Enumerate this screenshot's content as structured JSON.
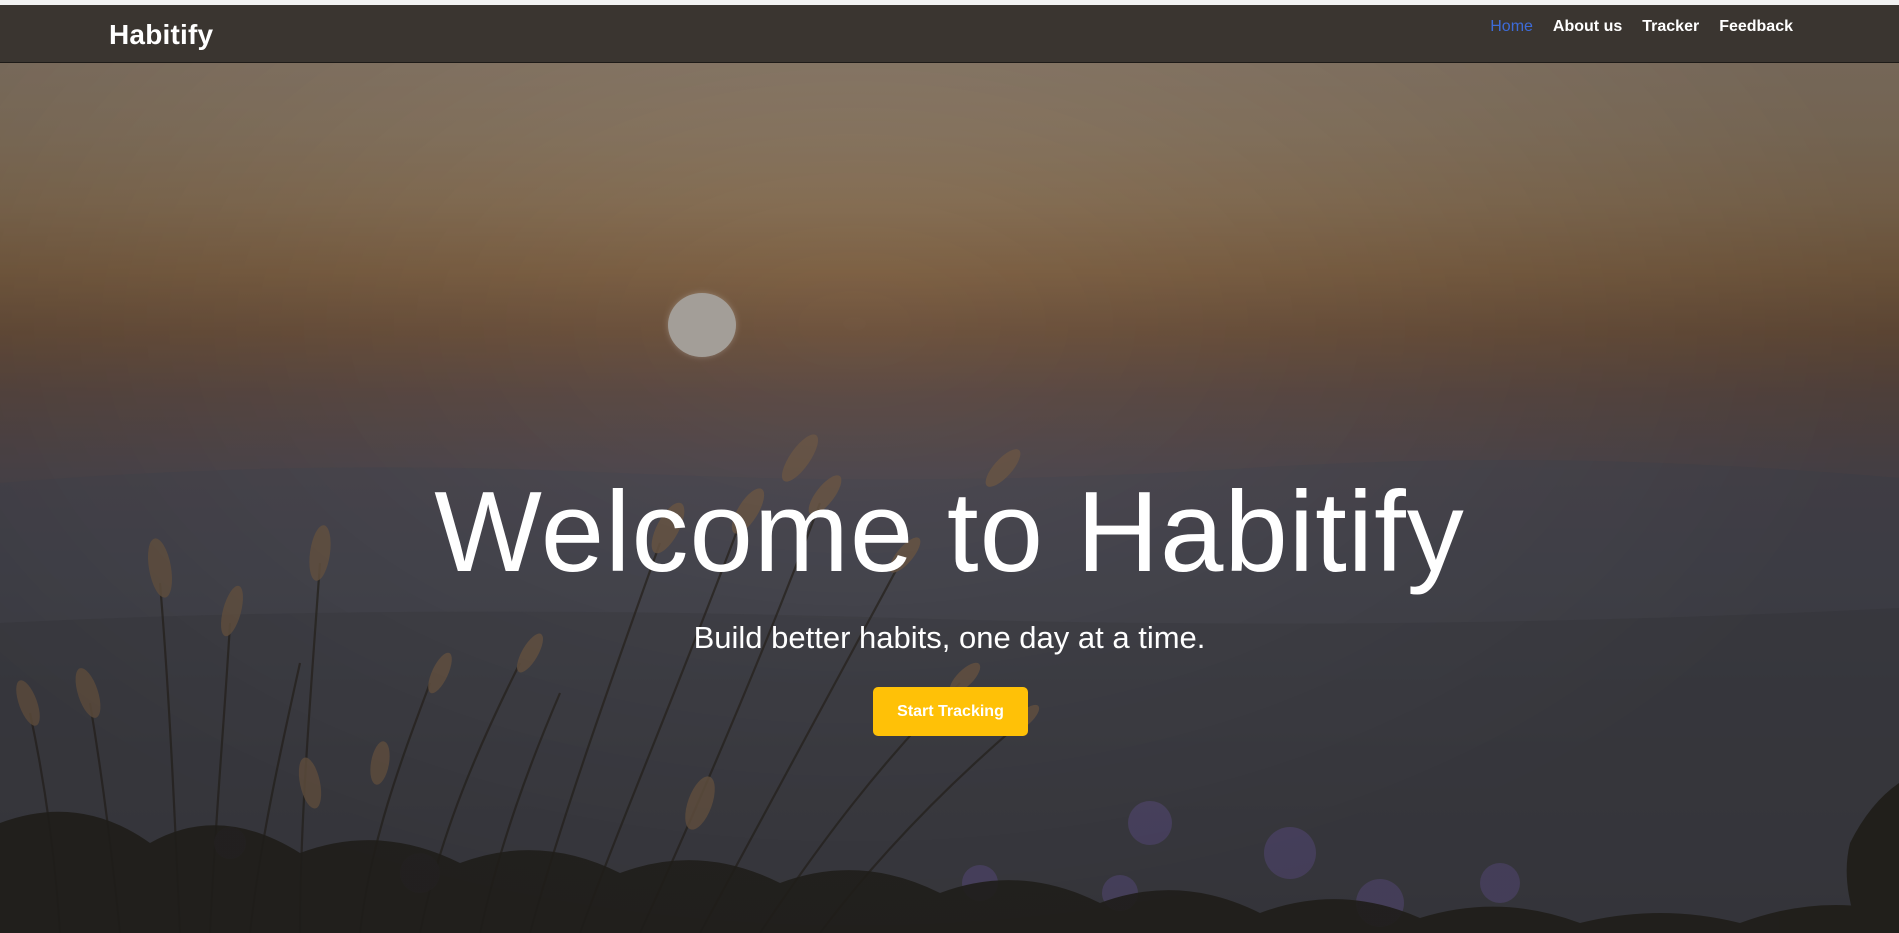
{
  "navbar": {
    "brand": "Habitify",
    "links": [
      {
        "label": "Home",
        "active": true
      },
      {
        "label": "About us",
        "active": false
      },
      {
        "label": "Tracker",
        "active": false
      },
      {
        "label": "Feedback",
        "active": false
      }
    ]
  },
  "hero": {
    "title": "Welcome to Habitify",
    "subtitle": "Build better habits, one day at a time.",
    "cta_label": "Start Tracking"
  },
  "colors": {
    "navbar_bg": "#3a3530",
    "active_link": "#3d6bd8",
    "cta_bg": "#ffc107",
    "text": "#ffffff"
  }
}
